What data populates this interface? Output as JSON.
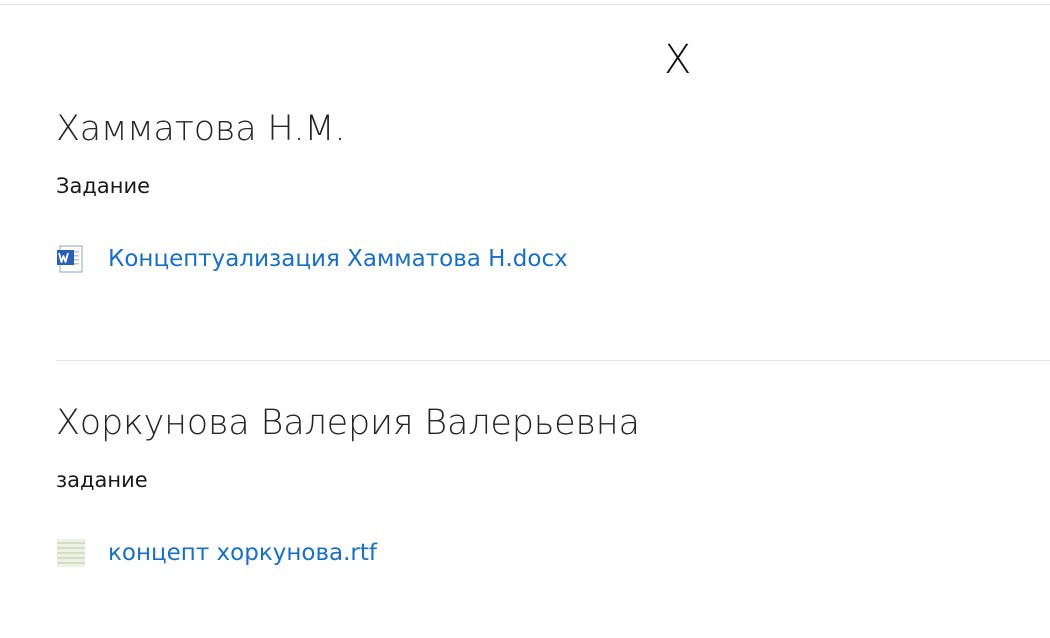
{
  "close_label": "X",
  "entries": [
    {
      "name": "Хамматова Н.М.",
      "label": "Задание",
      "file": {
        "name": "Концептуализация Хамматова Н.docx",
        "icon": "word-doc-icon"
      }
    },
    {
      "name": "Хоркунова Валерия Валерьевна",
      "label": "задание",
      "file": {
        "name": "концепт хоркунова.rtf",
        "icon": "rtf-doc-icon"
      }
    }
  ],
  "colors": {
    "link": "#1a6fc4",
    "divider": "#e3e3e3"
  }
}
